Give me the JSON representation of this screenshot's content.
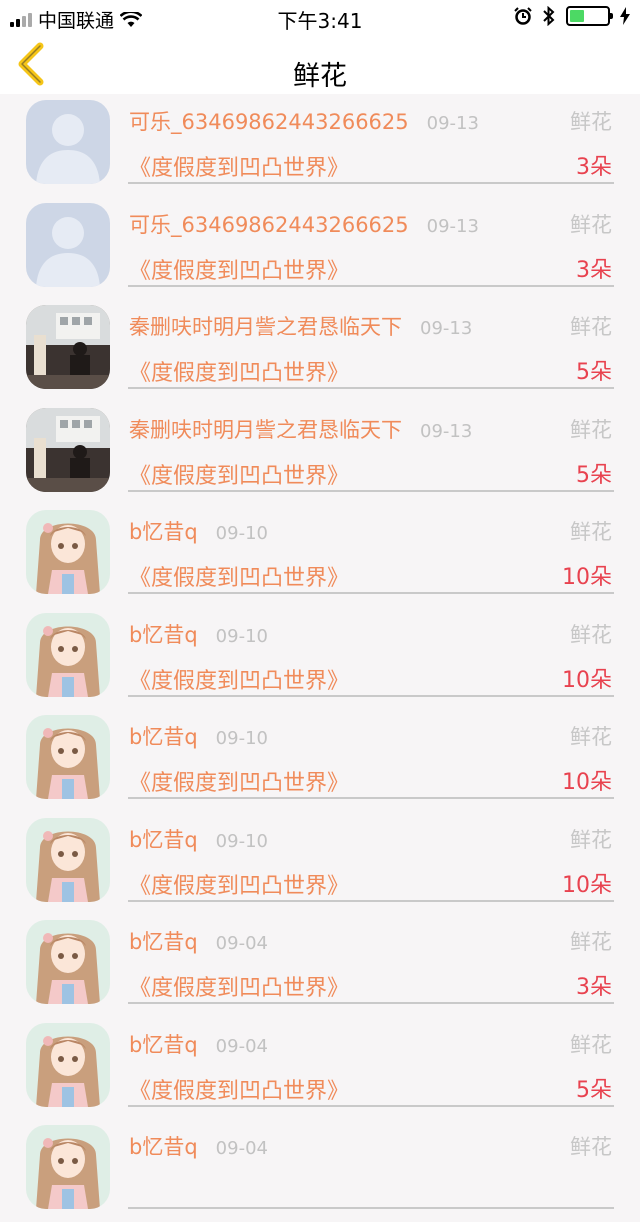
{
  "status_bar": {
    "carrier": "中国联通",
    "time": "下午3:41"
  },
  "nav": {
    "title": "鲜花"
  },
  "colors": {
    "accent": "#f08b5a",
    "count": "#e8424f",
    "muted": "#c2c2c2"
  },
  "rows": [
    {
      "name": "可乐_63469862443266625",
      "date": "09-13",
      "type": "鲜花",
      "book": "《度假度到凹凸世界》",
      "count": "3朵",
      "avatar": "default-avatar"
    },
    {
      "name": "可乐_63469862443266625",
      "date": "09-13",
      "type": "鲜花",
      "book": "《度假度到凹凸世界》",
      "count": "3朵",
      "avatar": "default-avatar"
    },
    {
      "name": "秦删呋时明月訾之君恳临天下",
      "date": "09-13",
      "type": "鲜花",
      "book": "《度假度到凹凸世界》",
      "count": "5朵",
      "avatar": "photo-avatar"
    },
    {
      "name": "秦删呋时明月訾之君恳临天下",
      "date": "09-13",
      "type": "鲜花",
      "book": "《度假度到凹凸世界》",
      "count": "5朵",
      "avatar": "photo-avatar"
    },
    {
      "name": "b忆昔q",
      "date": "09-10",
      "type": "鲜花",
      "book": "《度假度到凹凸世界》",
      "count": "10朵",
      "avatar": "anime-avatar"
    },
    {
      "name": "b忆昔q",
      "date": "09-10",
      "type": "鲜花",
      "book": "《度假度到凹凸世界》",
      "count": "10朵",
      "avatar": "anime-avatar"
    },
    {
      "name": "b忆昔q",
      "date": "09-10",
      "type": "鲜花",
      "book": "《度假度到凹凸世界》",
      "count": "10朵",
      "avatar": "anime-avatar"
    },
    {
      "name": "b忆昔q",
      "date": "09-10",
      "type": "鲜花",
      "book": "《度假度到凹凸世界》",
      "count": "10朵",
      "avatar": "anime-avatar"
    },
    {
      "name": "b忆昔q",
      "date": "09-04",
      "type": "鲜花",
      "book": "《度假度到凹凸世界》",
      "count": "3朵",
      "avatar": "anime-avatar"
    },
    {
      "name": "b忆昔q",
      "date": "09-04",
      "type": "鲜花",
      "book": "《度假度到凹凸世界》",
      "count": "5朵",
      "avatar": "anime-avatar"
    },
    {
      "name": "b忆昔q",
      "date": "09-04",
      "type": "鲜花",
      "book": "",
      "count": "",
      "avatar": "anime-avatar"
    }
  ]
}
